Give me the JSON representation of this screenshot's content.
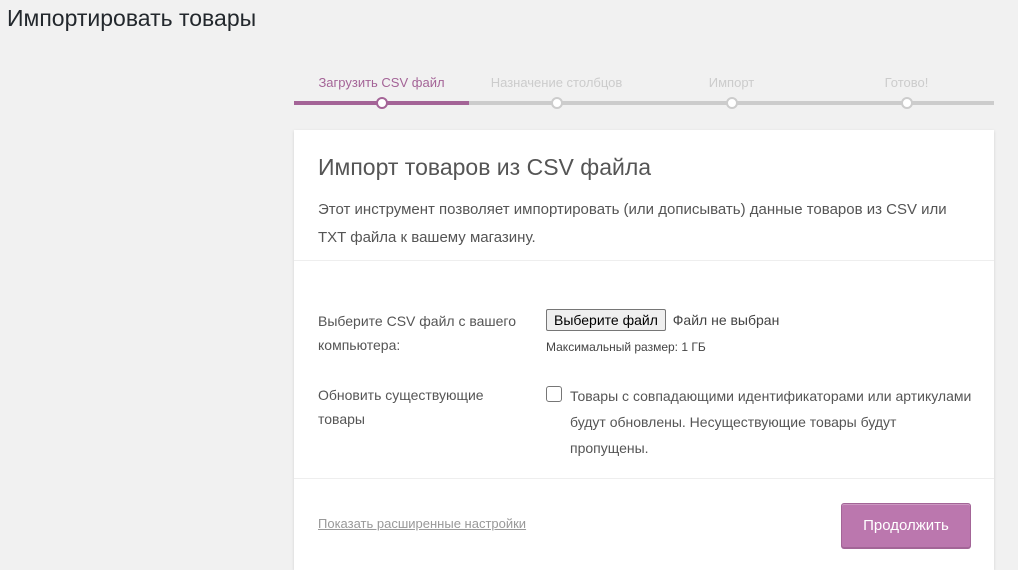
{
  "page": {
    "title": "Импортировать товары"
  },
  "steps": [
    {
      "label": "Загрузить CSV файл",
      "active": true
    },
    {
      "label": "Назначение столбцов",
      "active": false
    },
    {
      "label": "Импорт",
      "active": false
    },
    {
      "label": "Готово!",
      "active": false
    }
  ],
  "card": {
    "title": "Импорт товаров из CSV файла",
    "description": "Этот инструмент позволяет импортировать (или дописывать) данные товаров из CSV или TXT файла к вашему магазину."
  },
  "file_row": {
    "label": "Выберите CSV файл с вашего компьютера:",
    "button_label": "Выберите файл",
    "status": "Файл не выбран",
    "max_size": "Максимальный размер: 1 ГБ"
  },
  "update_row": {
    "label": "Обновить существующие товары",
    "checkbox_checked": false,
    "checkbox_text": "Товары с совпадающими идентификаторами или артикулами будут обновлены. Несуществующие товары будут пропущены."
  },
  "footer": {
    "advanced_link": "Показать расширенные настройки",
    "continue_label": "Продолжить"
  },
  "colors": {
    "accent": "#a46497",
    "button": "#bb77ae",
    "inactive": "#cccccc",
    "background": "#f1f1f1"
  }
}
